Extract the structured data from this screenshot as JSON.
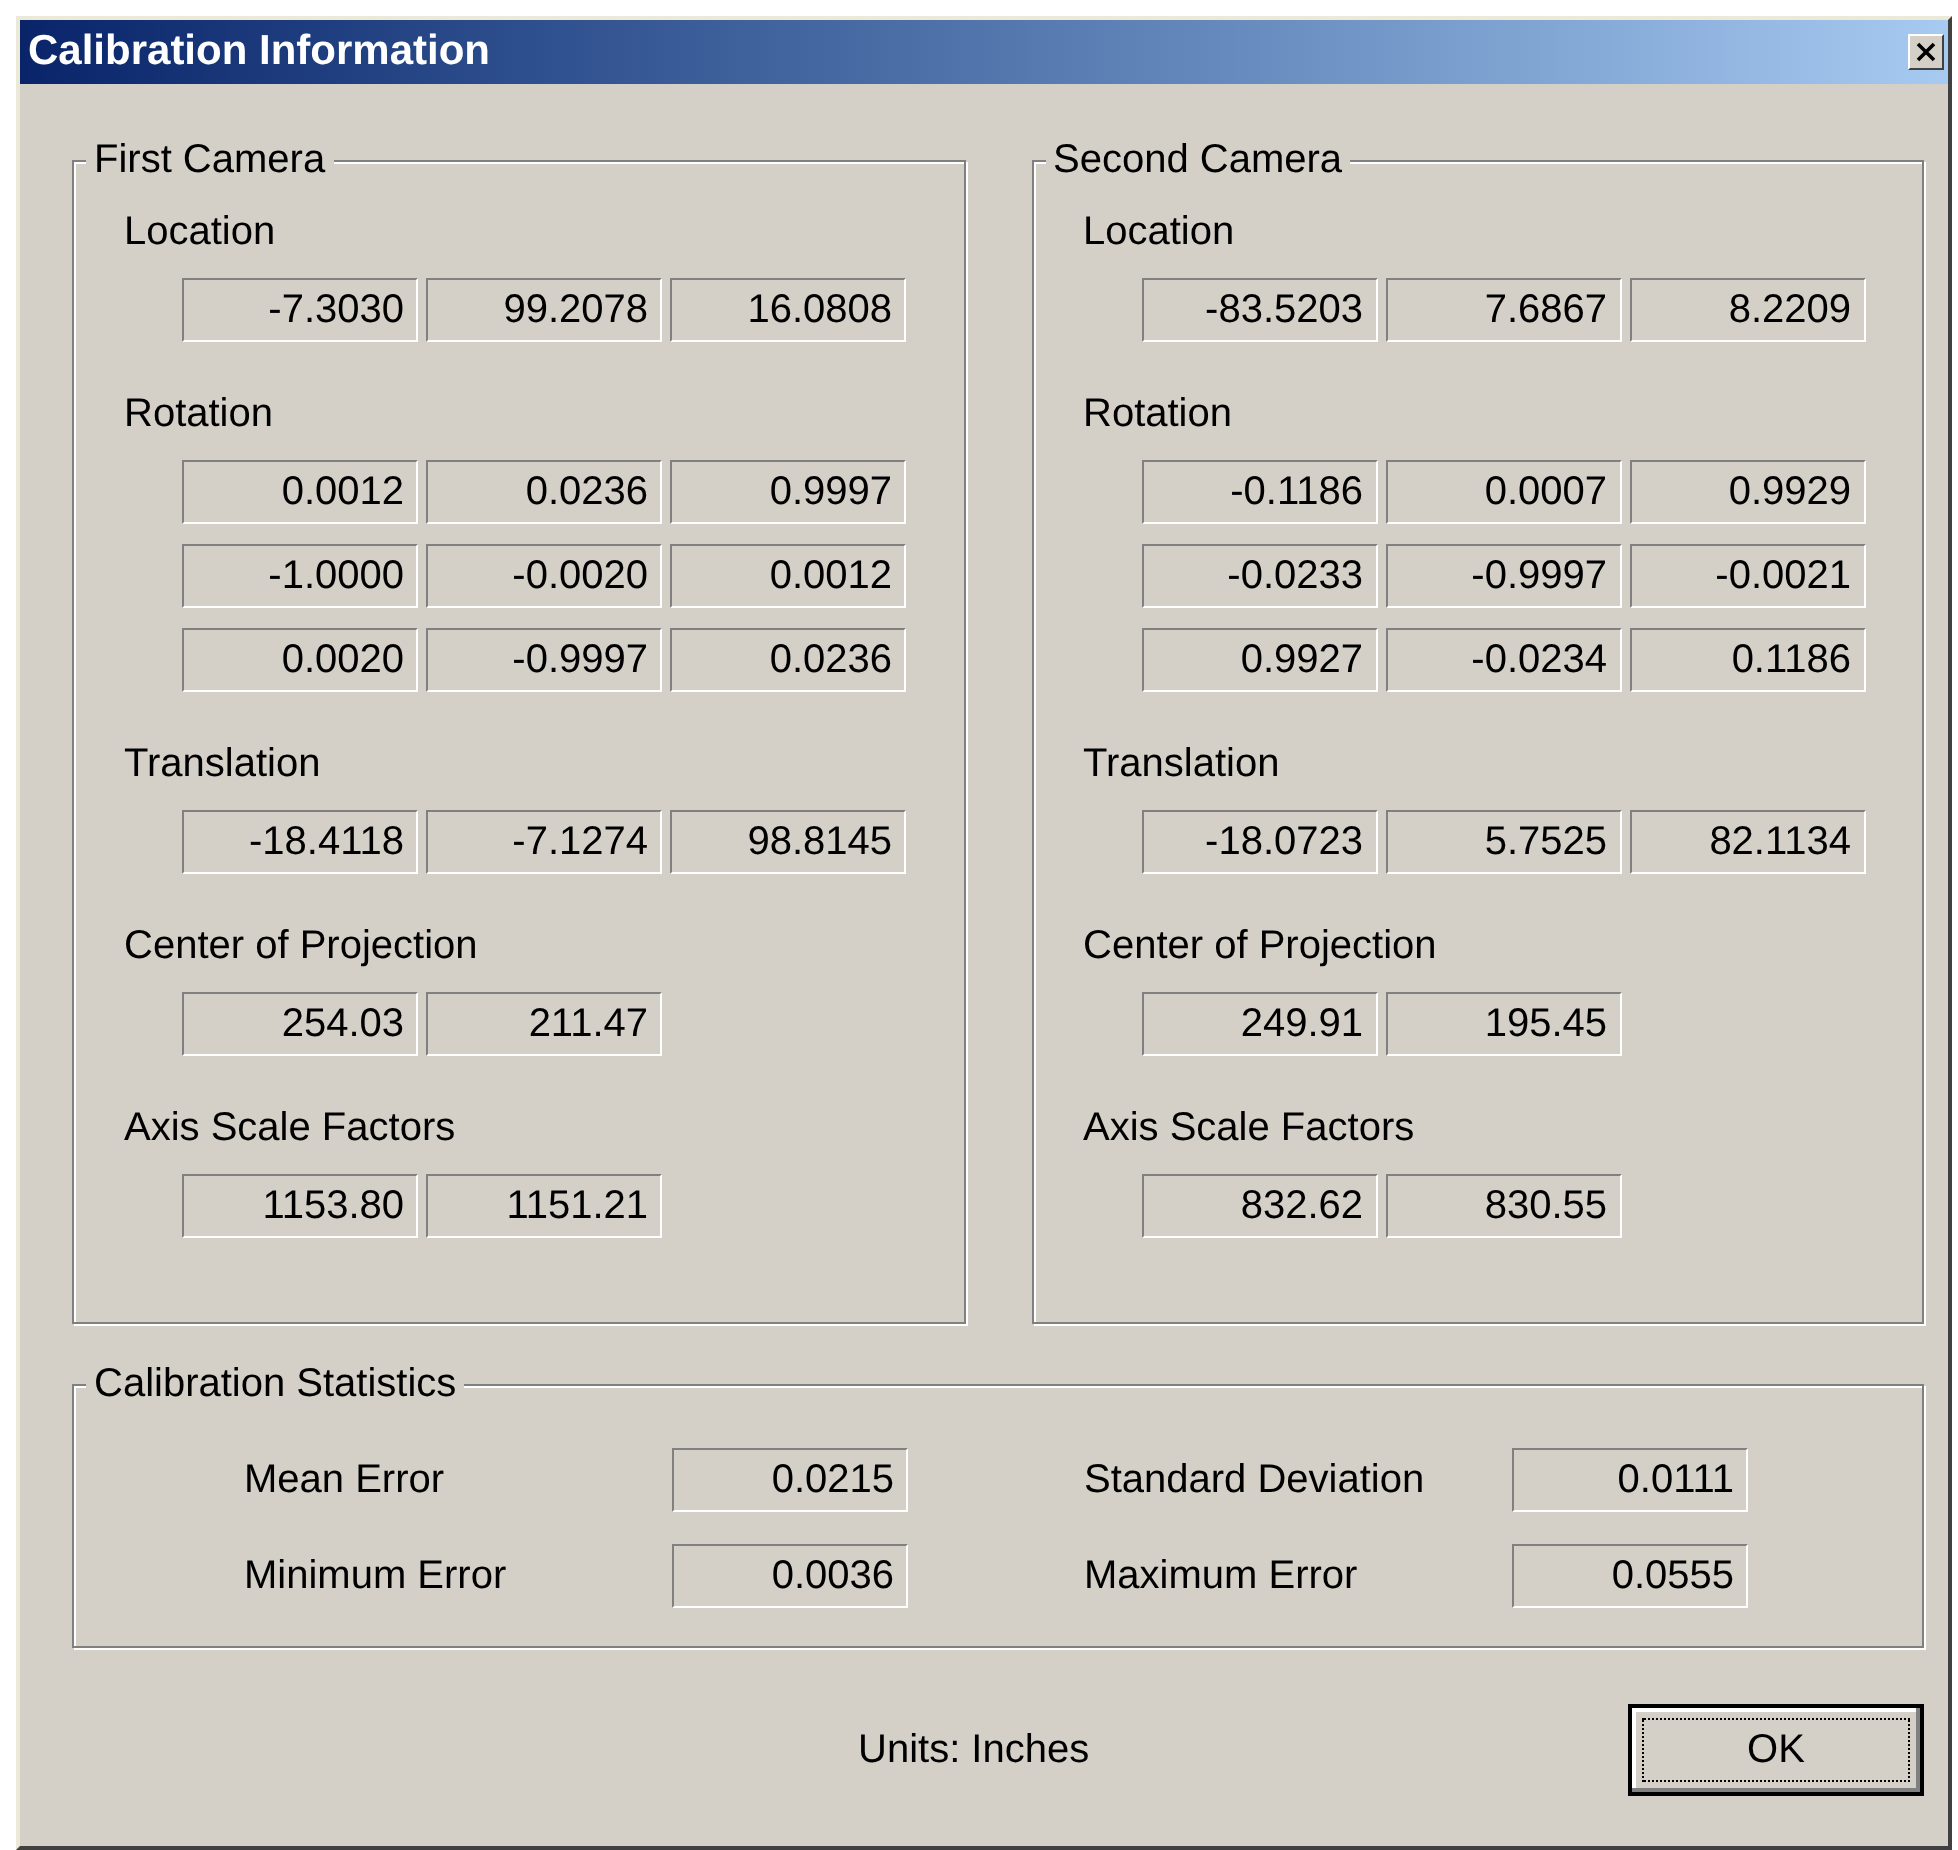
{
  "window": {
    "title": "Calibration Information"
  },
  "cameras": [
    {
      "title": "First Camera",
      "sections": [
        {
          "label": "Location",
          "rows": [
            [
              "-7.3030",
              "99.2078",
              "16.0808"
            ]
          ]
        },
        {
          "label": "Rotation",
          "rows": [
            [
              "0.0012",
              "0.0236",
              "0.9997"
            ],
            [
              "-1.0000",
              "-0.0020",
              "0.0012"
            ],
            [
              "0.0020",
              "-0.9997",
              "0.0236"
            ]
          ]
        },
        {
          "label": "Translation",
          "rows": [
            [
              "-18.4118",
              "-7.1274",
              "98.8145"
            ]
          ]
        },
        {
          "label": "Center of Projection",
          "rows": [
            [
              "254.03",
              "211.47"
            ]
          ]
        },
        {
          "label": "Axis Scale Factors",
          "rows": [
            [
              "1153.80",
              "1151.21"
            ]
          ]
        }
      ]
    },
    {
      "title": "Second Camera",
      "sections": [
        {
          "label": "Location",
          "rows": [
            [
              "-83.5203",
              "7.6867",
              "8.2209"
            ]
          ]
        },
        {
          "label": "Rotation",
          "rows": [
            [
              "-0.1186",
              "0.0007",
              "0.9929"
            ],
            [
              "-0.0233",
              "-0.9997",
              "-0.0021"
            ],
            [
              "0.9927",
              "-0.0234",
              "0.1186"
            ]
          ]
        },
        {
          "label": "Translation",
          "rows": [
            [
              "-18.0723",
              "5.7525",
              "82.1134"
            ]
          ]
        },
        {
          "label": "Center of Projection",
          "rows": [
            [
              "249.91",
              "195.45"
            ]
          ]
        },
        {
          "label": "Axis Scale Factors",
          "rows": [
            [
              "832.62",
              "830.55"
            ]
          ]
        }
      ]
    }
  ],
  "statistics": {
    "title": "Calibration Statistics",
    "items": [
      {
        "label": "Mean Error",
        "value": "0.0215"
      },
      {
        "label": "Standard Deviation",
        "value": "0.0111"
      },
      {
        "label": "Minimum Error",
        "value": "0.0036"
      },
      {
        "label": "Maximum Error",
        "value": "0.0555"
      }
    ]
  },
  "units": "Units: Inches",
  "ok_button": {
    "label": "OK",
    "focused": true
  }
}
